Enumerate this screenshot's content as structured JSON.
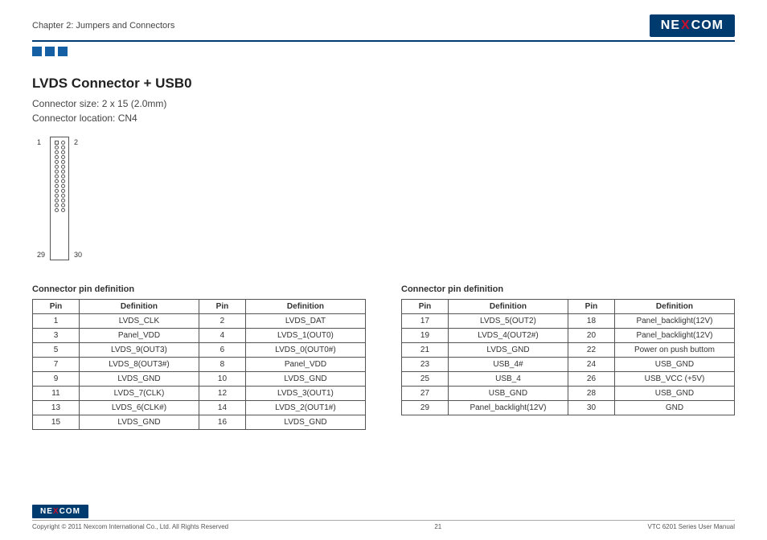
{
  "header": {
    "chapter": "Chapter 2: Jumpers and Connectors",
    "logo_pre": "NE",
    "logo_x": "X",
    "logo_post": "COM"
  },
  "title": "LVDS Connector + USB0",
  "sub1": "Connector size:  2 x 15 (2.0mm)",
  "sub2": "Connector location: CN4",
  "diagram": {
    "left_top": "1",
    "left_bottom": "29",
    "right_top": "2",
    "right_bottom": "30"
  },
  "table_title_left": "Connector pin definition",
  "table_title_right": "Connector pin definition",
  "headers": {
    "pin": "Pin",
    "def": "Definition"
  },
  "left": [
    {
      "p1": "1",
      "d1": "LVDS_CLK",
      "p2": "2",
      "d2": "LVDS_DAT"
    },
    {
      "p1": "3",
      "d1": "Panel_VDD",
      "p2": "4",
      "d2": "LVDS_1(OUT0)"
    },
    {
      "p1": "5",
      "d1": "LVDS_9(OUT3)",
      "p2": "6",
      "d2": "LVDS_0(OUT0#)"
    },
    {
      "p1": "7",
      "d1": "LVDS_8(OUT3#)",
      "p2": "8",
      "d2": "Panel_VDD"
    },
    {
      "p1": "9",
      "d1": "LVDS_GND",
      "p2": "10",
      "d2": "LVDS_GND"
    },
    {
      "p1": "11",
      "d1": "LVDS_7(CLK)",
      "p2": "12",
      "d2": "LVDS_3(OUT1)"
    },
    {
      "p1": "13",
      "d1": "LVDS_6(CLK#)",
      "p2": "14",
      "d2": "LVDS_2(OUT1#)"
    },
    {
      "p1": "15",
      "d1": "LVDS_GND",
      "p2": "16",
      "d2": "LVDS_GND"
    }
  ],
  "right": [
    {
      "p1": "17",
      "d1": "LVDS_5(OUT2)",
      "p2": "18",
      "d2": "Panel_backlight(12V)"
    },
    {
      "p1": "19",
      "d1": "LVDS_4(OUT2#)",
      "p2": "20",
      "d2": "Panel_backlight(12V)"
    },
    {
      "p1": "21",
      "d1": "LVDS_GND",
      "p2": "22",
      "d2": "Power on push buttom"
    },
    {
      "p1": "23",
      "d1": "USB_4#",
      "p2": "24",
      "d2": "USB_GND"
    },
    {
      "p1": "25",
      "d1": "USB_4",
      "p2": "26",
      "d2": "USB_VCC (+5V)"
    },
    {
      "p1": "27",
      "d1": "USB_GND",
      "p2": "28",
      "d2": "USB_GND"
    },
    {
      "p1": "29",
      "d1": "Panel_backlight(12V)",
      "p2": "30",
      "d2": "GND"
    }
  ],
  "footer": {
    "copyright": "Copyright © 2011 Nexcom International Co., Ltd. All Rights Reserved",
    "page": "21",
    "manual": "VTC 6201 Series User Manual"
  }
}
